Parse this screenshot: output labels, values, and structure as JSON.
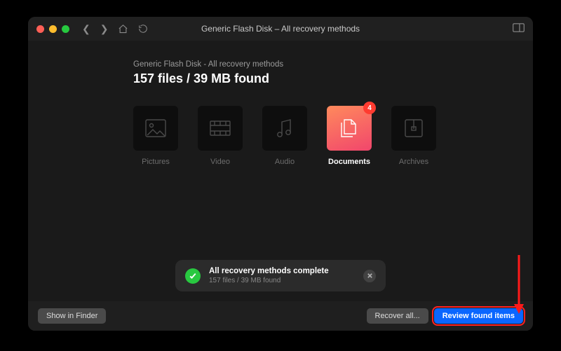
{
  "window": {
    "title": "Generic Flash Disk – All recovery methods"
  },
  "header": {
    "subtitle": "Generic Flash Disk - All recovery methods",
    "headline": "157 files / 39 MB found"
  },
  "categories": [
    {
      "id": "pictures",
      "label": "Pictures",
      "badge": null,
      "active": false
    },
    {
      "id": "video",
      "label": "Video",
      "badge": null,
      "active": false
    },
    {
      "id": "audio",
      "label": "Audio",
      "badge": null,
      "active": false
    },
    {
      "id": "documents",
      "label": "Documents",
      "badge": "4",
      "active": true
    },
    {
      "id": "archives",
      "label": "Archives",
      "badge": null,
      "active": false
    }
  ],
  "toast": {
    "title": "All recovery methods complete",
    "subtitle": "157 files / 39 MB found"
  },
  "footer": {
    "show_in_finder": "Show in Finder",
    "recover_all": "Recover all...",
    "review": "Review found items"
  }
}
